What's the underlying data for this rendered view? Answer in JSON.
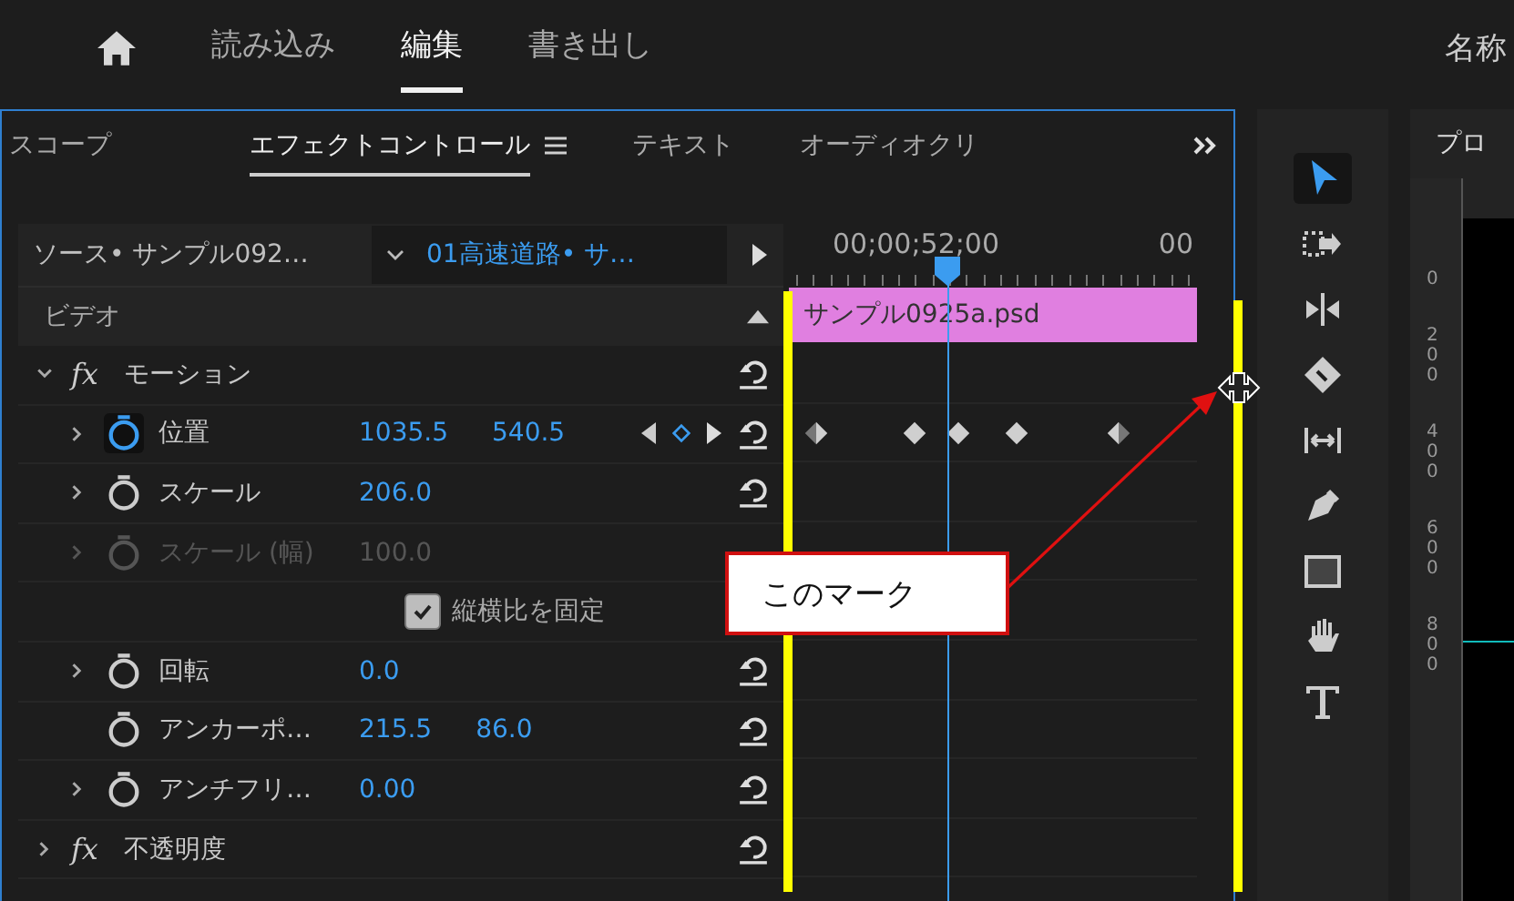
{
  "top_nav": {
    "tabs": [
      {
        "label": "読み込み",
        "selected": false
      },
      {
        "label": "編集",
        "selected": true
      },
      {
        "label": "書き出し",
        "selected": false
      }
    ],
    "project_title": "名称"
  },
  "panel": {
    "tabs": [
      {
        "label": "スコープ",
        "selected": false
      },
      {
        "label": "エフェクトコントロール",
        "selected": true
      },
      {
        "label": "テキスト",
        "selected": false
      },
      {
        "label": "オーディオクリ",
        "selected": false
      }
    ]
  },
  "source": {
    "label": "ソース• サンプル092…",
    "clip": "01高速道路• サ…"
  },
  "timeline": {
    "timecode": "00;00;52;00",
    "end_timecode": "00",
    "playhead": {
      "level": 0.39
    },
    "clip": "サンプル0925a.psd"
  },
  "section": "ビデオ",
  "rows": [
    {
      "kind": "effect",
      "badge": "fx",
      "name": "モーション",
      "expanded": true
    },
    {
      "kind": "property",
      "name": "位置",
      "values": [
        "1035.5",
        "540.5"
      ],
      "expandable": true,
      "animated": true,
      "disabled": false,
      "keyframes": [
        {
          "kind": "in"
        },
        {
          "kind": "full"
        },
        {
          "kind": "full"
        },
        {
          "kind": "full"
        },
        {
          "kind": "out"
        }
      ]
    },
    {
      "kind": "property",
      "name": "スケール",
      "values": [
        "206.0"
      ],
      "expandable": true,
      "animated": false,
      "disabled": false
    },
    {
      "kind": "property",
      "name": "スケール (幅)",
      "values": [
        "100.0"
      ],
      "expandable": true,
      "animated": false,
      "disabled": true
    },
    {
      "kind": "checkbox",
      "label": "縦横比を固定",
      "checked": true
    },
    {
      "kind": "property",
      "name": "回転",
      "values": [
        "0.0"
      ],
      "expandable": true,
      "animated": false,
      "disabled": false
    },
    {
      "kind": "property",
      "name": "アンカーポ…",
      "values": [
        "215.5",
        "86.0"
      ],
      "expandable": false,
      "animated": false,
      "disabled": false
    },
    {
      "kind": "property",
      "name": "アンチフリ…",
      "values": [
        "0.00"
      ],
      "expandable": true,
      "animated": false,
      "disabled": false
    },
    {
      "kind": "effect",
      "badge": "fx",
      "name": "不透明度",
      "expanded": false
    }
  ],
  "tools": [
    {
      "kind": "select",
      "selected": true
    },
    {
      "kind": "track",
      "selected": false
    },
    {
      "kind": "ripple",
      "selected": false
    },
    {
      "kind": "razor",
      "selected": false
    },
    {
      "kind": "slip",
      "selected": false
    },
    {
      "kind": "pen",
      "selected": false
    },
    {
      "kind": "rect",
      "selected": false
    },
    {
      "kind": "hand",
      "selected": false
    },
    {
      "kind": "type",
      "selected": false
    }
  ],
  "program": {
    "tab": "プロ",
    "ruler": [
      "0",
      "200",
      "400",
      "600",
      "800"
    ]
  },
  "annotation": {
    "callout": "このマーク"
  }
}
